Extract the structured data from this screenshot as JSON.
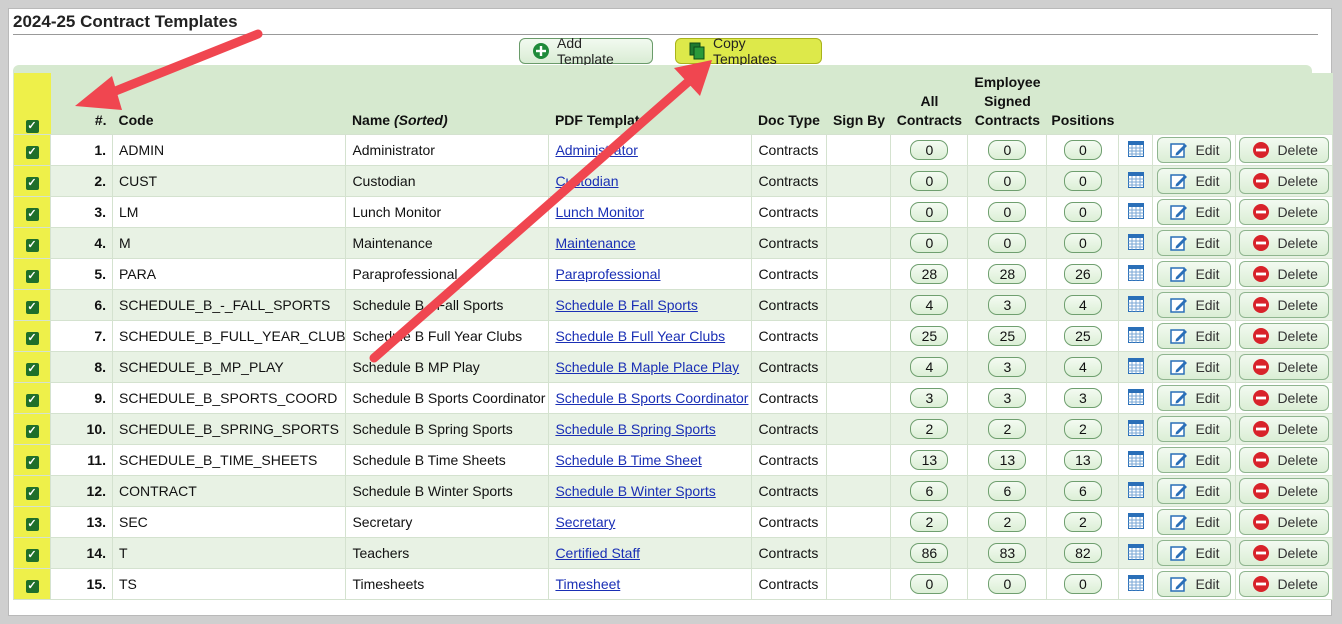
{
  "page": {
    "title": "2024-25 Contract Templates"
  },
  "toolbar": {
    "add_label": "Add Template",
    "copy_label": "Copy Templates"
  },
  "table": {
    "headers": {
      "num": "#.",
      "code": "Code",
      "name": "Name",
      "name_sorted": "(Sorted)",
      "pdf": "PDF Template",
      "doctype": "Doc Type",
      "signby": "Sign By",
      "all_contracts_1": "All",
      "all_contracts_2": "Contracts",
      "emp_signed_1": "Employee",
      "emp_signed_2": "Signed",
      "emp_signed_3": "Contracts",
      "positions": "Positions"
    },
    "edit_label": "Edit",
    "delete_label": "Delete",
    "rows": [
      {
        "num": "1.",
        "code": "ADMIN",
        "name": "Administrator",
        "pdf": "Administrator",
        "doctype": "Contracts",
        "signby": "",
        "all": "0",
        "signed": "0",
        "positions": "0"
      },
      {
        "num": "2.",
        "code": "CUST",
        "name": "Custodian",
        "pdf": "Custodian",
        "doctype": "Contracts",
        "signby": "",
        "all": "0",
        "signed": "0",
        "positions": "0"
      },
      {
        "num": "3.",
        "code": "LM",
        "name": "Lunch Monitor",
        "pdf": "Lunch Monitor",
        "doctype": "Contracts",
        "signby": "",
        "all": "0",
        "signed": "0",
        "positions": "0"
      },
      {
        "num": "4.",
        "code": "M",
        "name": "Maintenance",
        "pdf": "Maintenance",
        "doctype": "Contracts",
        "signby": "",
        "all": "0",
        "signed": "0",
        "positions": "0"
      },
      {
        "num": "5.",
        "code": "PARA",
        "name": "Paraprofessional",
        "pdf": "Paraprofessional",
        "doctype": "Contracts",
        "signby": "",
        "all": "28",
        "signed": "28",
        "positions": "26"
      },
      {
        "num": "6.",
        "code": "SCHEDULE_B_-_FALL_SPORTS",
        "name": "Schedule B - Fall Sports",
        "pdf": "Schedule B Fall Sports",
        "doctype": "Contracts",
        "signby": "",
        "all": "4",
        "signed": "3",
        "positions": "4"
      },
      {
        "num": "7.",
        "code": "SCHEDULE_B_FULL_YEAR_CLUB",
        "name": "Schedule B Full Year Clubs",
        "pdf": "Schedule B Full Year Clubs",
        "doctype": "Contracts",
        "signby": "",
        "all": "25",
        "signed": "25",
        "positions": "25"
      },
      {
        "num": "8.",
        "code": "SCHEDULE_B_MP_PLAY",
        "name": "Schedule B MP Play",
        "pdf": "Schedule B Maple Place Play",
        "doctype": "Contracts",
        "signby": "",
        "all": "4",
        "signed": "3",
        "positions": "4"
      },
      {
        "num": "9.",
        "code": "SCHEDULE_B_SPORTS_COORD",
        "name": "Schedule B Sports Coordinator",
        "pdf": "Schedule B Sports Coordinator",
        "doctype": "Contracts",
        "signby": "",
        "all": "3",
        "signed": "3",
        "positions": "3"
      },
      {
        "num": "10.",
        "code": "SCHEDULE_B_SPRING_SPORTS",
        "name": "Schedule B Spring Sports",
        "pdf": "Schedule B Spring Sports",
        "doctype": "Contracts",
        "signby": "",
        "all": "2",
        "signed": "2",
        "positions": "2"
      },
      {
        "num": "11.",
        "code": "SCHEDULE_B_TIME_SHEETS",
        "name": "Schedule B Time Sheets",
        "pdf": "Schedule B Time Sheet",
        "doctype": "Contracts",
        "signby": "",
        "all": "13",
        "signed": "13",
        "positions": "13"
      },
      {
        "num": "12.",
        "code": "CONTRACT",
        "name": "Schedule B Winter Sports",
        "pdf": "Schedule B Winter Sports",
        "doctype": "Contracts",
        "signby": "",
        "all": "6",
        "signed": "6",
        "positions": "6"
      },
      {
        "num": "13.",
        "code": "SEC",
        "name": "Secretary",
        "pdf": "Secretary",
        "doctype": "Contracts",
        "signby": "",
        "all": "2",
        "signed": "2",
        "positions": "2"
      },
      {
        "num": "14.",
        "code": "T",
        "name": "Teachers",
        "pdf": "Certified Staff",
        "doctype": "Contracts",
        "signby": "",
        "all": "86",
        "signed": "83",
        "positions": "82"
      },
      {
        "num": "15.",
        "code": "TS",
        "name": "Timesheets",
        "pdf": "Timesheet",
        "doctype": "Contracts",
        "signby": "",
        "all": "0",
        "signed": "0",
        "positions": "0"
      }
    ]
  },
  "colors": {
    "annotation_arrow": "#f04650",
    "header_bg": "#d6e9cf",
    "checkbox_highlight": "#eef04a"
  }
}
